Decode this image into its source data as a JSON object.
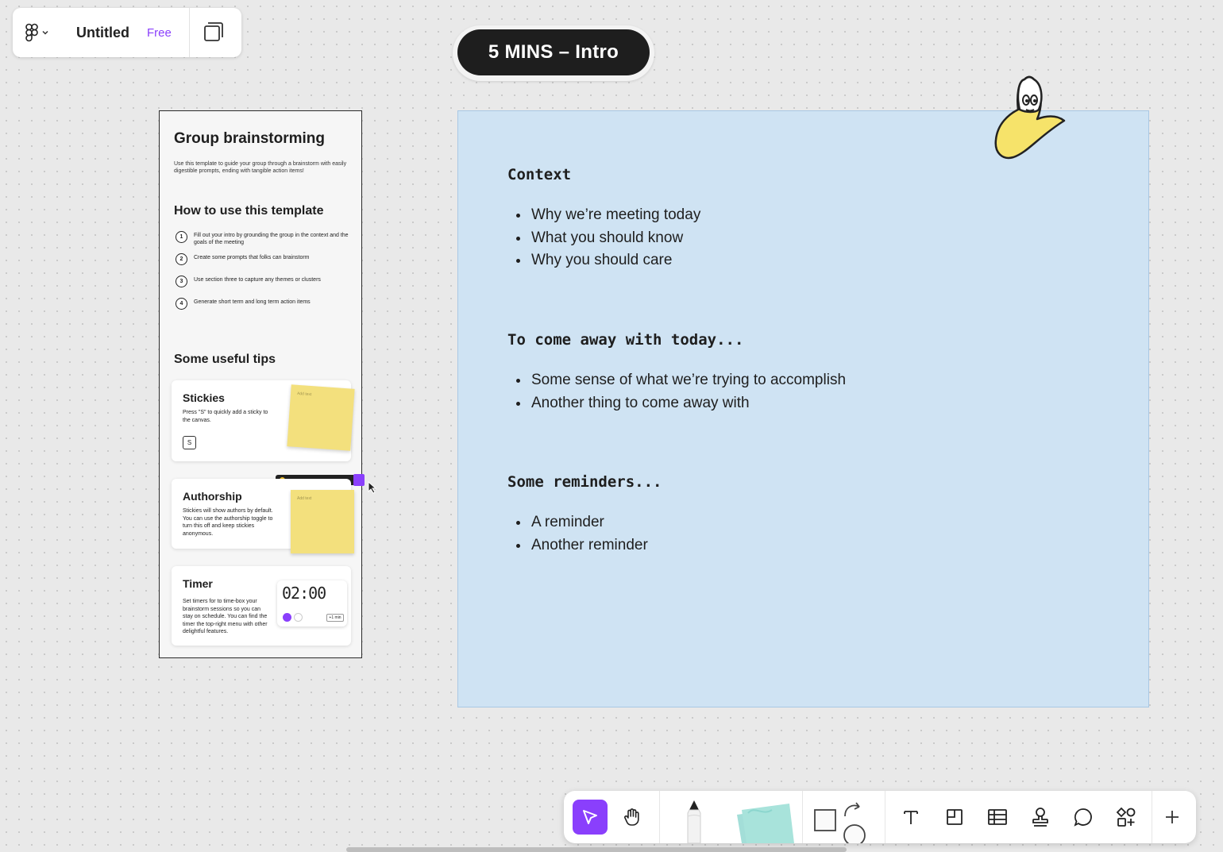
{
  "file": {
    "title": "Untitled",
    "plan_badge": "Free",
    "logo_icon": "figma-logo-icon",
    "pages_icon": "pages-icon"
  },
  "section": {
    "label": "5 MINS – Intro"
  },
  "template": {
    "title": "Group brainstorming",
    "description": "Use this template to guide your group through a brainstorm with easily digestible prompts, ending with tangible action items!",
    "how_to_title": "How to use this template",
    "steps": [
      {
        "num": "1",
        "text": "Fill out your intro by grounding the group in the context and the goals of the meeting"
      },
      {
        "num": "2",
        "text": "Create some prompts that folks can brainstorm"
      },
      {
        "num": "3",
        "text": "Use section three to capture any themes or clusters"
      },
      {
        "num": "4",
        "text": "Generate short term and long term action items"
      }
    ],
    "tips_title": "Some useful tips",
    "tips": [
      {
        "title": "Stickies",
        "text": "Press \"S\" to quickly add a sticky to the canvas.",
        "key": "S"
      },
      {
        "title": "Authorship",
        "text": "Stickies will show authors by default. You can use the authorship toggle to turn this off and keep stickies anonymous."
      },
      {
        "title": "Timer",
        "text": "Set timers for to time-box your brainstorm sessions so you can stay on schedule. You can find the timer the top-right menu with other delightful features.",
        "clock": "02:00"
      }
    ]
  },
  "content": {
    "sections": [
      {
        "heading": "Context",
        "items": [
          "Why we’re meeting today",
          "What you should know",
          "Why you should care"
        ]
      },
      {
        "heading": "To come away with today...",
        "items": [
          "Some sense of what we’re trying to accomplish",
          "Another thing to come away with"
        ]
      },
      {
        "heading": "Some reminders...",
        "items": [
          "A reminder",
          "Another reminder"
        ]
      }
    ],
    "frame_color": "#cfe3f3"
  },
  "toolbar": {
    "accent": "#8a3ffc",
    "tools": [
      "move-tool",
      "hand-tool",
      "marker-tool",
      "sticky-tool",
      "shape-tool",
      "text-tool",
      "section-tool",
      "table-tool",
      "stamp-tool",
      "comment-tool",
      "widgets-tool",
      "more-tool"
    ]
  }
}
